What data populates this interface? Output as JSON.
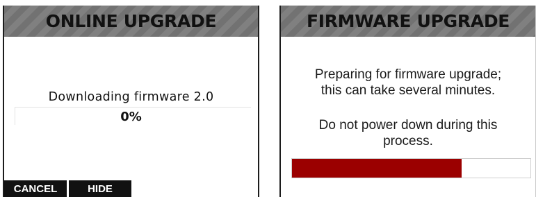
{
  "online_upgrade": {
    "title": "ONLINE UPGRADE",
    "status_text": "Downloading firmware 2.0",
    "progress_label": "0%",
    "progress_fraction": 0.0,
    "buttons": {
      "cancel": "CANCEL",
      "hide": "HIDE"
    }
  },
  "firmware_upgrade": {
    "title": "FIRMWARE UPGRADE",
    "message_1": "Preparing for firmware upgrade; this can take several minutes.",
    "message_2": "Do not power down during this process.",
    "progress_fraction": 0.71
  },
  "colors": {
    "header_bg": "#727272",
    "progress_fill": "#9b0000",
    "softkey_bg": "#111111"
  }
}
